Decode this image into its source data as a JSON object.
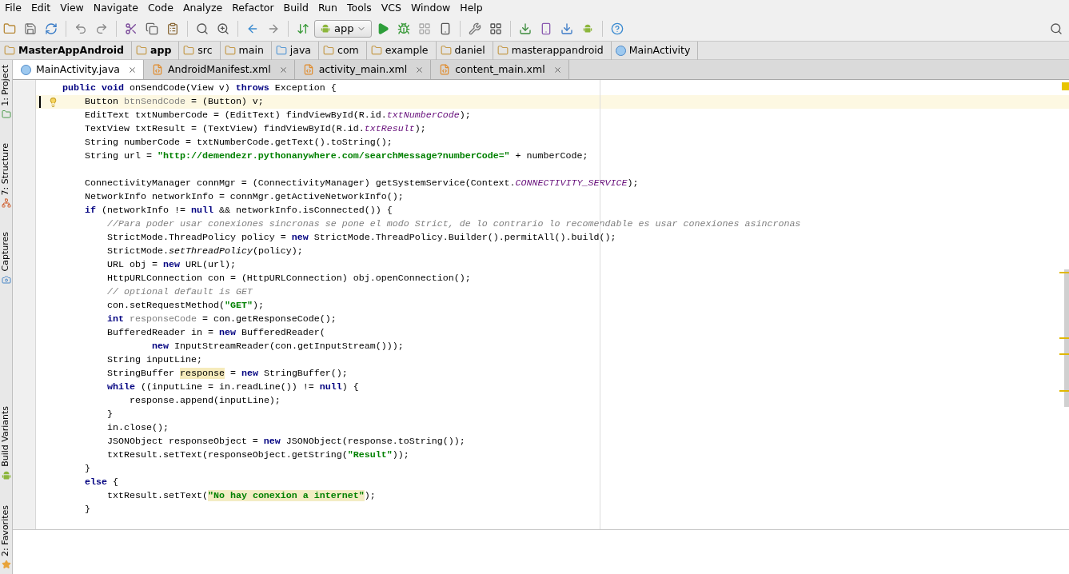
{
  "menu": [
    "File",
    "Edit",
    "View",
    "Navigate",
    "Code",
    "Analyze",
    "Refactor",
    "Build",
    "Run",
    "Tools",
    "VCS",
    "Window",
    "Help"
  ],
  "toolbar": {
    "run_config": "app"
  },
  "breadcrumb": [
    {
      "label": "MasterAppAndroid",
      "kind": "project"
    },
    {
      "label": "app",
      "kind": "module"
    },
    {
      "label": "src",
      "kind": "folder"
    },
    {
      "label": "main",
      "kind": "folder"
    },
    {
      "label": "java",
      "kind": "source"
    },
    {
      "label": "com",
      "kind": "package"
    },
    {
      "label": "example",
      "kind": "package"
    },
    {
      "label": "daniel",
      "kind": "package"
    },
    {
      "label": "masterappandroid",
      "kind": "package"
    },
    {
      "label": "MainActivity",
      "kind": "class"
    }
  ],
  "tabs": [
    {
      "label": "MainActivity.java",
      "kind": "java",
      "selected": true
    },
    {
      "label": "AndroidManifest.xml",
      "kind": "xml",
      "selected": false
    },
    {
      "label": "activity_main.xml",
      "kind": "xml",
      "selected": false
    },
    {
      "label": "content_main.xml",
      "kind": "xml",
      "selected": false
    }
  ],
  "tool_windows": [
    {
      "label": "1: Project",
      "kind": "project"
    },
    {
      "label": "7: Structure",
      "kind": "structure"
    },
    {
      "label": "Captures",
      "kind": "captures"
    },
    {
      "label": "Build Variants",
      "kind": "variants"
    },
    {
      "label": "2: Favorites",
      "kind": "favorites"
    }
  ],
  "code": [
    {
      "current": false,
      "tokens": [
        {
          "text": "public void",
          "kind": "keyword"
        },
        {
          "text": " onSendCode(View v) ",
          "kind": "plain"
        },
        {
          "text": "throws",
          "kind": "keyword"
        },
        {
          "text": " Exception {",
          "kind": "plain"
        }
      ],
      "children": [
        {
          "current": true,
          "tokens": [
            {
              "text": "Button ",
              "kind": "plain"
            },
            {
              "text": "btnSendCode",
              "kind": "unused"
            },
            {
              "text": " = (Button) v;",
              "kind": "plain"
            }
          ]
        },
        {
          "current": false,
          "tokens": [
            {
              "text": "EditText txtNumberCode = (EditText) findViewById(R.id.",
              "kind": "plain"
            },
            {
              "text": "txtNumberCode",
              "kind": "field"
            },
            {
              "text": ");",
              "kind": "plain"
            }
          ]
        },
        {
          "current": false,
          "tokens": [
            {
              "text": "TextView txtResult = (TextView) findViewById(R.id.",
              "kind": "plain"
            },
            {
              "text": "txtResult",
              "kind": "field"
            },
            {
              "text": ");",
              "kind": "plain"
            }
          ]
        },
        {
          "current": false,
          "tokens": [
            {
              "text": "String numberCode = txtNumberCode.getText().toString();",
              "kind": "plain"
            }
          ]
        },
        {
          "current": false,
          "tokens": [
            {
              "text": "String url = ",
              "kind": "plain"
            },
            {
              "text": "\"http://demendezr.pythonanywhere.com/searchMessage?numberCode=\"",
              "kind": "string"
            },
            {
              "text": " + numberCode;",
              "kind": "plain"
            }
          ]
        },
        {
          "current": false
        },
        {
          "current": false,
          "tokens": [
            {
              "text": "ConnectivityManager connMgr = (ConnectivityManager) getSystemService(Context.",
              "kind": "plain"
            },
            {
              "text": "CONNECTIVITY_SERVICE",
              "kind": "field"
            },
            {
              "text": ");",
              "kind": "plain"
            }
          ]
        },
        {
          "current": false,
          "tokens": [
            {
              "text": "NetworkInfo networkInfo = connMgr.getActiveNetworkInfo();",
              "kind": "plain"
            }
          ]
        },
        {
          "current": false,
          "tokens": [
            {
              "text": "if",
              "kind": "keyword"
            },
            {
              "text": " (networkInfo != ",
              "kind": "plain"
            },
            {
              "text": "null",
              "kind": "keyword"
            },
            {
              "text": " && networkInfo.isConnected()) {",
              "kind": "plain"
            }
          ],
          "children": [
            {
              "current": false,
              "tokens": [
                {
                  "text": "//Para poder usar conexiones sincronas se pone el modo Strict, de lo contrario lo recomendable es usar conexiones asincronas",
                  "kind": "comment"
                }
              ]
            },
            {
              "current": false,
              "tokens": [
                {
                  "text": "StrictMode.ThreadPolicy policy = ",
                  "kind": "plain"
                },
                {
                  "text": "new",
                  "kind": "keyword"
                },
                {
                  "text": " StrictMode.ThreadPolicy.Builder().permitAll().build();",
                  "kind": "plain"
                }
              ]
            },
            {
              "current": false,
              "tokens": [
                {
                  "text": "StrictMode.",
                  "kind": "plain"
                },
                {
                  "text": "setThreadPolicy",
                  "kind": "static"
                },
                {
                  "text": "(policy);",
                  "kind": "plain"
                }
              ]
            },
            {
              "current": false,
              "tokens": [
                {
                  "text": "URL obj = ",
                  "kind": "plain"
                },
                {
                  "text": "new",
                  "kind": "keyword"
                },
                {
                  "text": " URL(url);",
                  "kind": "plain"
                }
              ]
            },
            {
              "current": false,
              "tokens": [
                {
                  "text": "HttpURLConnection con = (HttpURLConnection) obj.openConnection();",
                  "kind": "plain"
                }
              ]
            },
            {
              "current": false,
              "tokens": [
                {
                  "text": "// optional default is GET",
                  "kind": "comment"
                }
              ]
            },
            {
              "current": false,
              "tokens": [
                {
                  "text": "con.setRequestMethod(",
                  "kind": "plain"
                },
                {
                  "text": "\"GET\"",
                  "kind": "string"
                },
                {
                  "text": ");",
                  "kind": "plain"
                }
              ]
            },
            {
              "current": false,
              "tokens": [
                {
                  "text": "int ",
                  "kind": "keyword"
                },
                {
                  "text": "responseCode",
                  "kind": "unused"
                },
                {
                  "text": " = con.getResponseCode();",
                  "kind": "plain"
                }
              ]
            },
            {
              "current": false,
              "tokens": [
                {
                  "text": "BufferedReader in = ",
                  "kind": "plain"
                },
                {
                  "text": "new",
                  "kind": "keyword"
                },
                {
                  "text": " BufferedReader(",
                  "kind": "plain"
                }
              ],
              "children": [
                {
                  "current": false,
                  "kind": "continuation",
                  "tokens": [
                    {
                      "text": "new",
                      "kind": "keyword"
                    },
                    {
                      "text": " InputStreamReader(con.getInputStream()));",
                      "kind": "plain"
                    }
                  ]
                }
              ]
            },
            {
              "current": false,
              "tokens": [
                {
                  "text": "String inputLine;",
                  "kind": "plain"
                }
              ]
            },
            {
              "current": false,
              "tokens": [
                {
                  "text": "StringBuffer ",
                  "kind": "plain"
                },
                {
                  "text": "response",
                  "kind": "highlight"
                },
                {
                  "text": " = ",
                  "kind": "plain"
                },
                {
                  "text": "new",
                  "kind": "keyword"
                },
                {
                  "text": " StringBuffer();",
                  "kind": "plain"
                }
              ]
            },
            {
              "current": false,
              "tokens": [
                {
                  "text": "while",
                  "kind": "keyword"
                },
                {
                  "text": " ((inputLine = in.readLine()) != ",
                  "kind": "plain"
                },
                {
                  "text": "null",
                  "kind": "keyword"
                },
                {
                  "text": ") {",
                  "kind": "plain"
                }
              ],
              "children": [
                {
                  "current": false,
                  "tokens": [
                    {
                      "text": "response.append(inputLine);",
                      "kind": "plain"
                    }
                  ]
                }
              ]
            },
            {
              "current": false,
              "tokens": [
                {
                  "text": "}",
                  "kind": "plain"
                }
              ]
            },
            {
              "current": false,
              "tokens": [
                {
                  "text": "in.close();",
                  "kind": "plain"
                }
              ]
            },
            {
              "current": false,
              "tokens": [
                {
                  "text": "JSONObject responseObject = ",
                  "kind": "plain"
                },
                {
                  "text": "new",
                  "kind": "keyword"
                },
                {
                  "text": " JSONObject(response.toString());",
                  "kind": "plain"
                }
              ]
            },
            {
              "current": false,
              "tokens": [
                {
                  "text": "txtResult.setText(responseObject.getString(",
                  "kind": "plain"
                },
                {
                  "text": "\"Result\"",
                  "kind": "string"
                },
                {
                  "text": "));",
                  "kind": "plain"
                }
              ]
            }
          ]
        },
        {
          "current": false,
          "tokens": [
            {
              "text": "}",
              "kind": "plain"
            }
          ]
        },
        {
          "current": false,
          "tokens": [
            {
              "text": "else",
              "kind": "keyword"
            },
            {
              "text": " {",
              "kind": "plain"
            }
          ],
          "children": [
            {
              "current": false,
              "tokens": [
                {
                  "text": "txtResult.setText(",
                  "kind": "plain"
                },
                {
                  "text": "\"No hay conexion a internet\"",
                  "kind": "string_highlight"
                },
                {
                  "text": ");",
                  "kind": "plain"
                }
              ]
            }
          ]
        },
        {
          "current": false,
          "tokens": [
            {
              "text": "}",
              "kind": "plain"
            }
          ]
        }
      ]
    }
  ]
}
